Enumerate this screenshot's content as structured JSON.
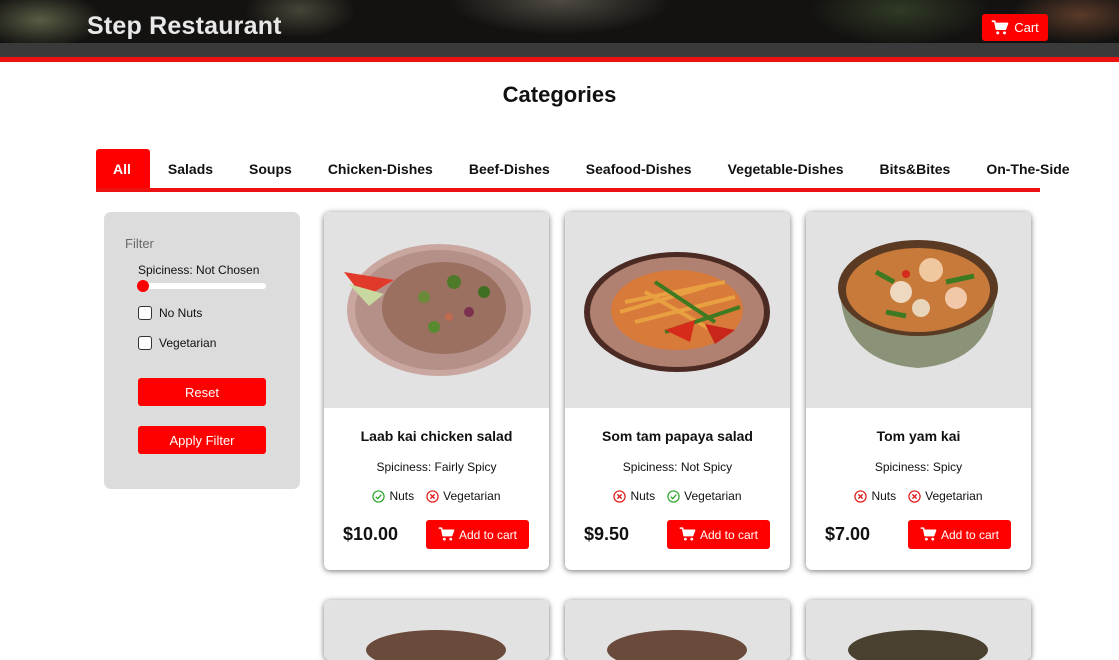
{
  "header": {
    "brand": "Step Restaurant",
    "cart_label": "Cart",
    "cart_icon": "shopping-cart-icon"
  },
  "page": {
    "title": "Categories"
  },
  "tabs": [
    {
      "label": "All",
      "active": true
    },
    {
      "label": "Salads",
      "active": false
    },
    {
      "label": "Soups",
      "active": false
    },
    {
      "label": "Chicken-Dishes",
      "active": false
    },
    {
      "label": "Beef-Dishes",
      "active": false
    },
    {
      "label": "Seafood-Dishes",
      "active": false
    },
    {
      "label": "Vegetable-Dishes",
      "active": false
    },
    {
      "label": "Bits&Bites",
      "active": false
    },
    {
      "label": "On-The-Side",
      "active": false
    }
  ],
  "filter": {
    "title": "Filter",
    "spiciness_label": "Spiciness: Not Chosen",
    "spiciness_value": 0,
    "no_nuts_label": "No Nuts",
    "no_nuts_checked": false,
    "vegetarian_label": "Vegetarian",
    "vegetarian_checked": false,
    "reset_label": "Reset",
    "apply_label": "Apply Filter"
  },
  "products": [
    {
      "name": "Laab kai chicken salad",
      "spiciness": "Spiciness: Fairly Spicy",
      "nuts_label": "Nuts",
      "nuts": true,
      "veg_label": "Vegetarian",
      "vegetarian": false,
      "price": "$10.00",
      "button": "Add to cart"
    },
    {
      "name": "Som tam papaya salad",
      "spiciness": "Spiciness: Not Spicy",
      "nuts_label": "Nuts",
      "nuts": false,
      "veg_label": "Vegetarian",
      "vegetarian": true,
      "price": "$9.50",
      "button": "Add to cart"
    },
    {
      "name": "Tom yam kai",
      "spiciness": "Spiciness: Spicy",
      "nuts_label": "Nuts",
      "nuts": false,
      "veg_label": "Vegetarian",
      "vegetarian": false,
      "price": "$7.00",
      "button": "Add to cart"
    }
  ],
  "colors": {
    "accent": "#ff0000",
    "check_green": "#2aa52a",
    "cross_red": "#e01818",
    "panel": "#dcdcdc"
  }
}
